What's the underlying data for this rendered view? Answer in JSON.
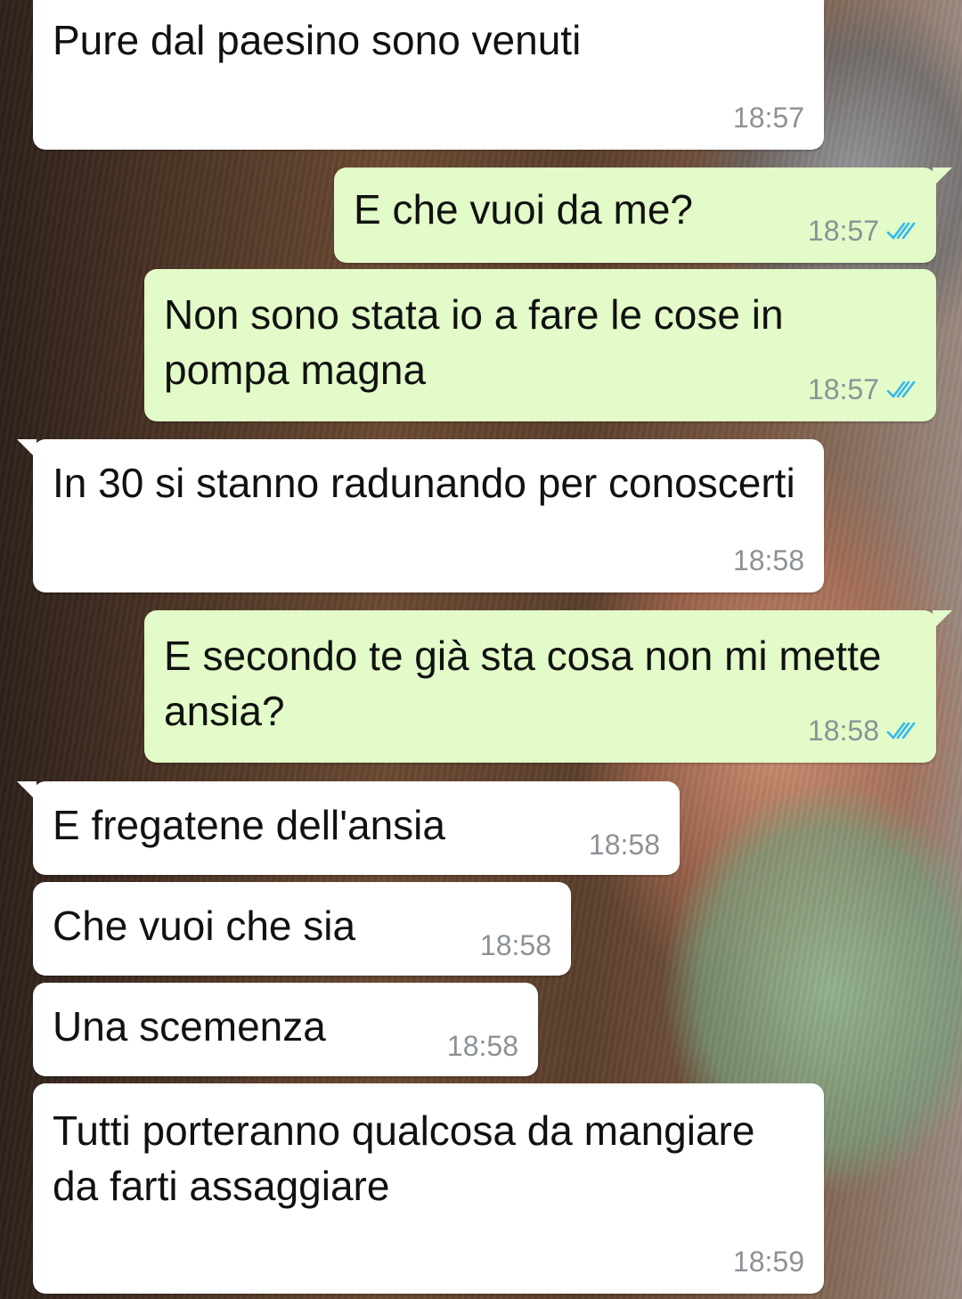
{
  "theme": {
    "incoming_bg": "#ffffff",
    "outgoing_bg": "#e2fbc8",
    "time_color": "#8c9196",
    "read_tick_color": "#34b7f1"
  },
  "messages": [
    {
      "direction": "incoming",
      "text": "Pure dal paesino sono venuti",
      "time": "18:57"
    },
    {
      "direction": "outgoing",
      "text": "E che vuoi da me?",
      "time": "18:57",
      "status_icon": "double-check-read-icon"
    },
    {
      "direction": "outgoing",
      "text": "Non sono stata io a fare le cose in pompa magna",
      "time": "18:57",
      "status_icon": "double-check-read-icon"
    },
    {
      "direction": "incoming",
      "text": "In 30 si stanno radunando per conoscerti",
      "time": "18:58"
    },
    {
      "direction": "outgoing",
      "text": "E secondo te già sta cosa non mi mette ansia?",
      "time": "18:58",
      "status_icon": "double-check-read-icon"
    },
    {
      "direction": "incoming",
      "text": "E fregatene dell'ansia",
      "time": "18:58"
    },
    {
      "direction": "incoming",
      "text": "Che vuoi che sia",
      "time": "18:58"
    },
    {
      "direction": "incoming",
      "text": "Una scemenza",
      "time": "18:58"
    },
    {
      "direction": "incoming",
      "text": "Tutti porteranno qualcosa da mangiare da farti assaggiare",
      "time": "18:59"
    }
  ]
}
